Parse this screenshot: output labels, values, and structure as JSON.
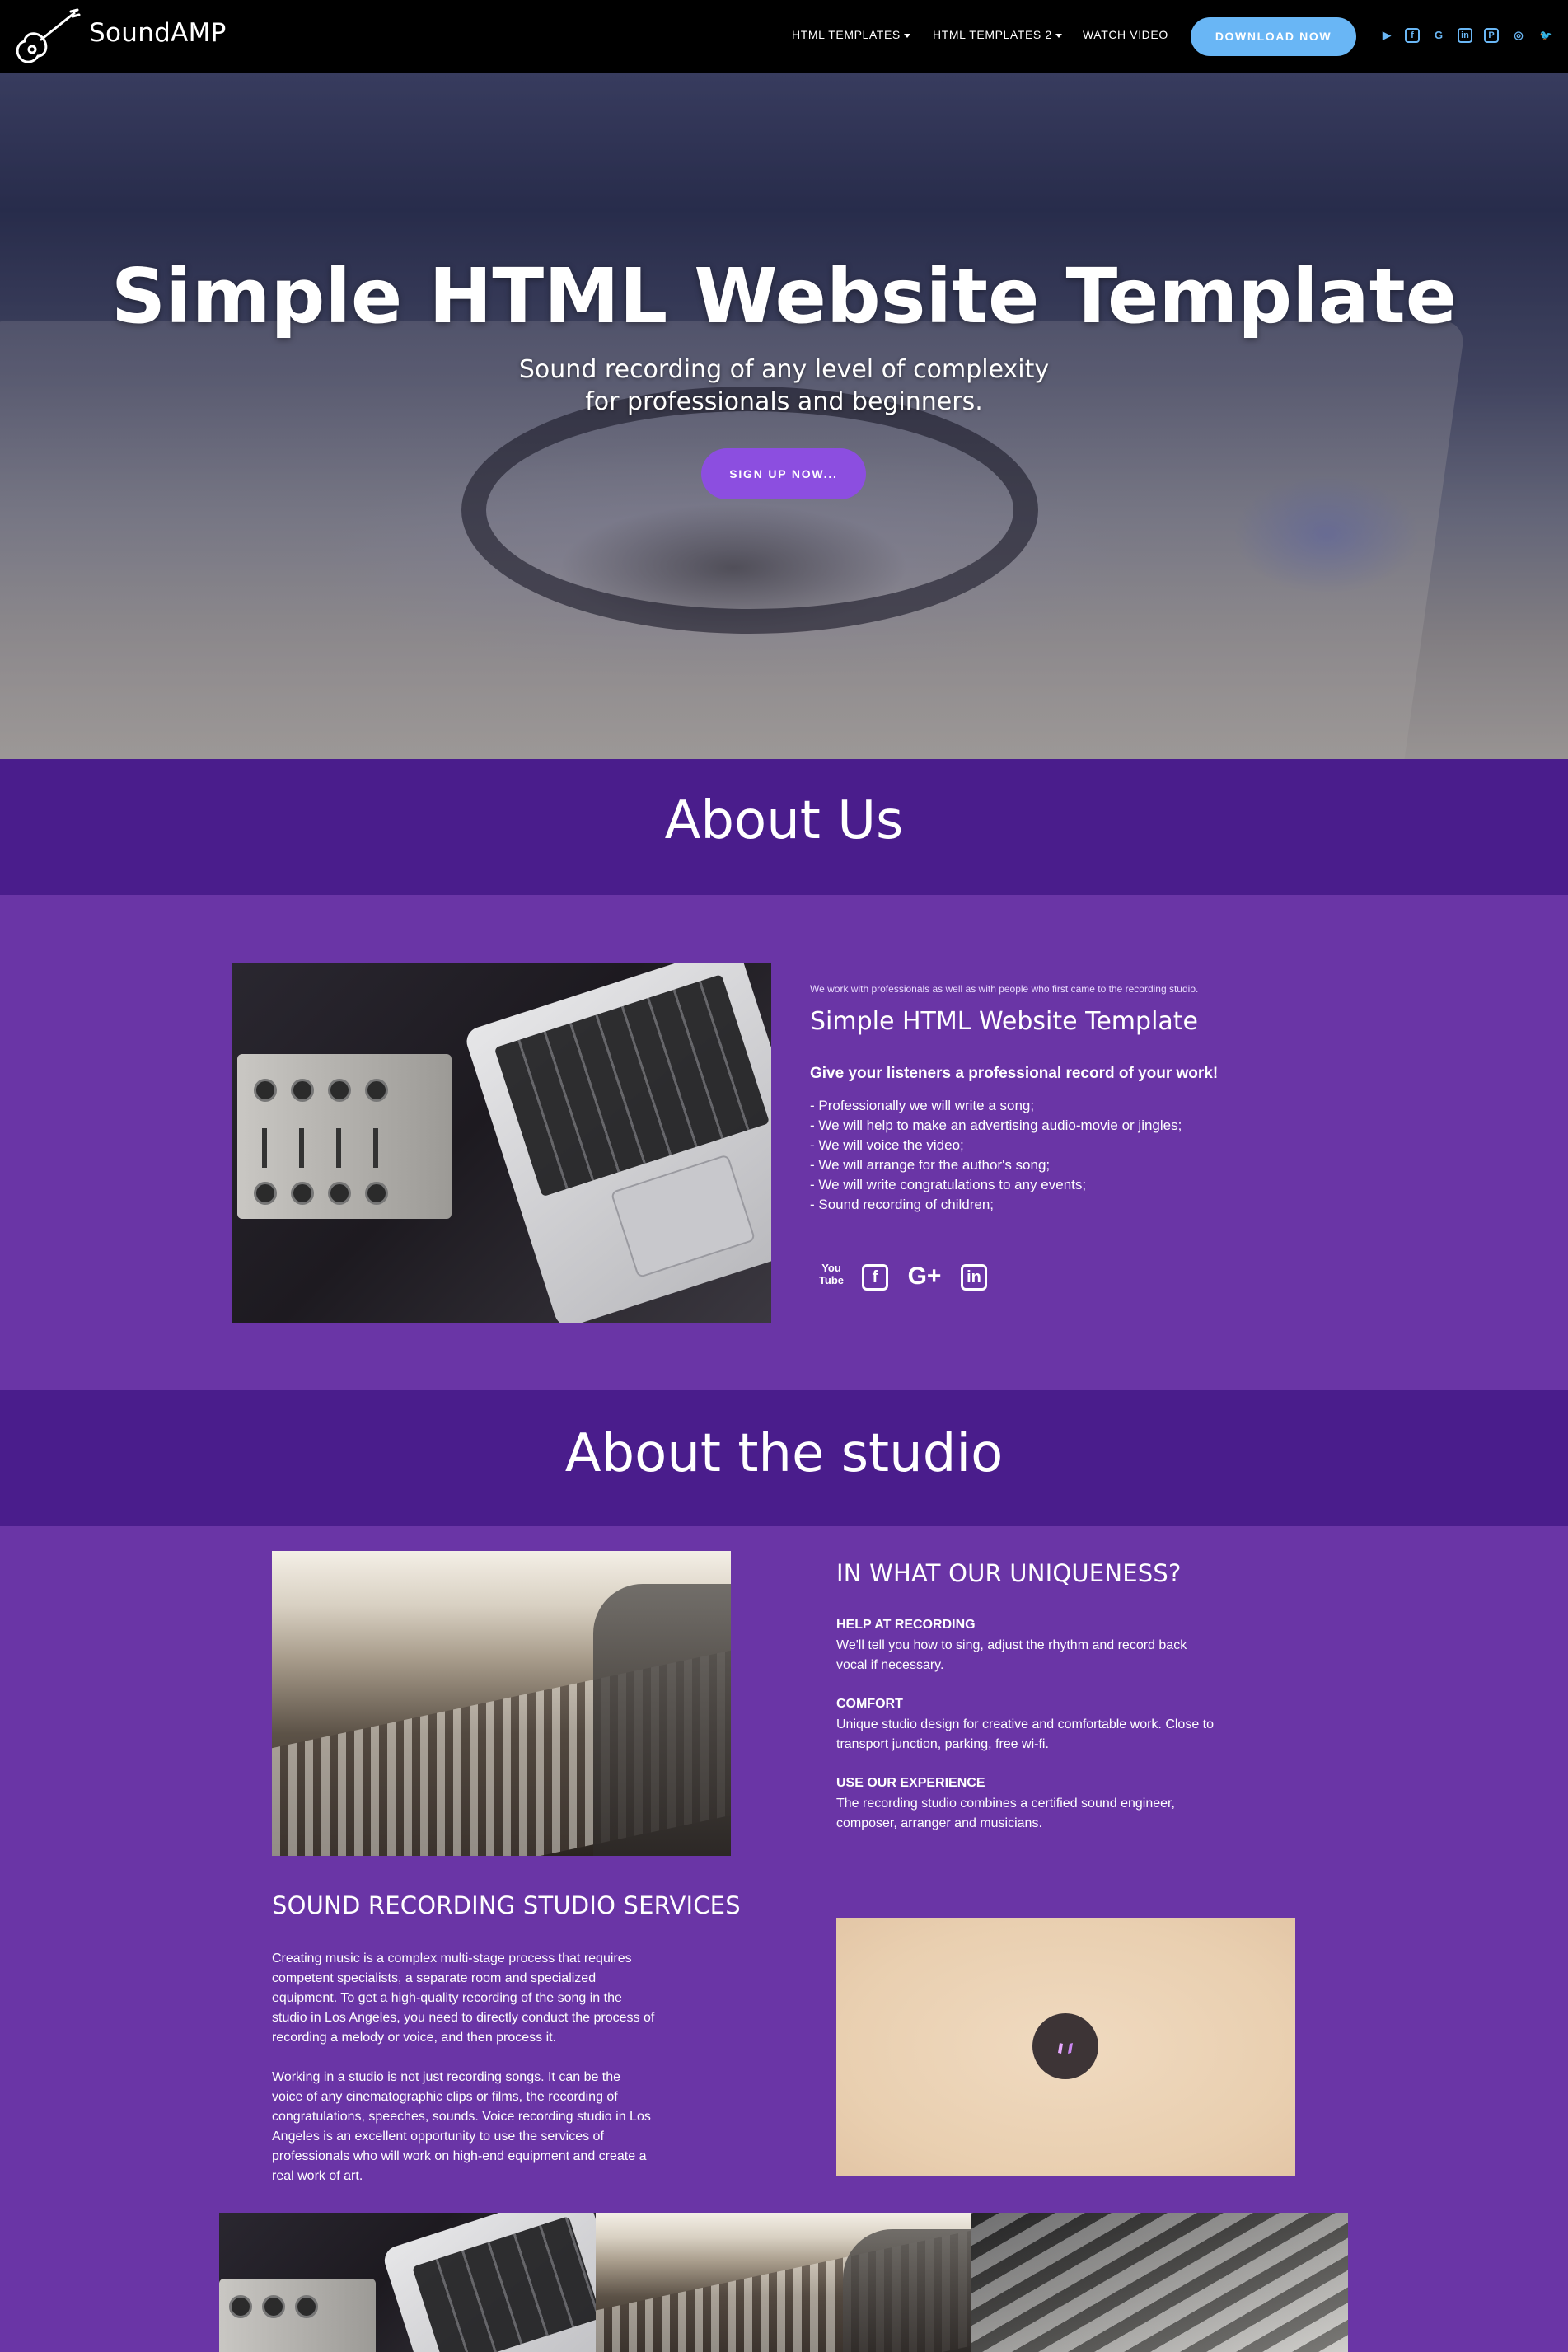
{
  "nav": {
    "brand": "SoundAMP",
    "menu": [
      {
        "label": "HTML TEMPLATES",
        "has_caret": true
      },
      {
        "label": "HTML TEMPLATES 2",
        "has_caret": true
      },
      {
        "label": "WATCH VIDEO",
        "has_caret": false
      }
    ],
    "download_label": "DOWNLOAD NOW",
    "social": [
      {
        "icon": "youtube-icon",
        "glyph": "▶"
      },
      {
        "icon": "facebook-icon",
        "glyph": "f"
      },
      {
        "icon": "google-plus-icon",
        "glyph": "G"
      },
      {
        "icon": "linkedin-icon",
        "glyph": "in"
      },
      {
        "icon": "pinterest-icon",
        "glyph": "P"
      },
      {
        "icon": "instagram-icon",
        "glyph": "◎"
      },
      {
        "icon": "twitter-icon",
        "glyph": "🐦"
      }
    ],
    "accent_color": "#69b6f5"
  },
  "hero": {
    "title": "Simple HTML Website Template",
    "subtitle_line1": "Sound recording of any level of complexity",
    "subtitle_line2": "for professionals and beginners.",
    "cta_label": "SIGN UP NOW...",
    "cta_color": "#8c4ee0"
  },
  "about": {
    "section_title": "About Us",
    "intro": "We work with professionals as well as with people who first came to the recording studio.",
    "heading": "Simple HTML Website Template",
    "subheading": "Give your listeners a professional record of your work!",
    "services": [
      "- Professionally we will write a song;",
      "- We will help to make an advertising audio-movie or jingles;",
      "- We will voice the video;",
      "- We will arrange for the author's song;",
      "- We will write congratulations to any events;",
      "- Sound recording of children;"
    ],
    "social": [
      {
        "icon": "youtube-icon",
        "glyph": "You\nTube"
      },
      {
        "icon": "facebook-icon",
        "glyph": "f"
      },
      {
        "icon": "google-plus-icon",
        "glyph": "G+"
      },
      {
        "icon": "linkedin-icon",
        "glyph": "in"
      }
    ]
  },
  "studio": {
    "section_title": "About the studio",
    "uniqueness_heading": "IN WHAT OUR UNIQUENESS?",
    "features": [
      {
        "title": "HELP AT RECORDING",
        "text_line1": "We'll tell you how to sing, adjust the rhythm and record back",
        "text_line2": "vocal if necessary."
      },
      {
        "title": "COMFORT",
        "text_line1": "Unique studio design for creative and comfortable work. Close to",
        "text_line2": "transport junction, parking, free wi-fi."
      },
      {
        "title": "USE OUR EXPERIENCE",
        "text_line1": "The recording studio combines a certified sound engineer,",
        "text_line2": "composer, arranger and musicians."
      }
    ],
    "services_heading": "SOUND RECORDING STUDIO SERVICES",
    "para1": [
      "Creating music is a complex multi-stage process that requires",
      "competent specialists, a separate room and specialized",
      "equipment. To get a high-quality recording of the song in the",
      "studio in Los Angeles, you need to directly conduct the process of",
      "recording a melody or voice, and then process it."
    ],
    "para2": [
      "Working in a studio is not just recording songs. It can be the",
      "voice of any cinematographic clips or films, the recording of",
      "congratulations, speeches, sounds. Voice recording studio in Los",
      "Angeles is an excellent opportunity to use the services of",
      "professionals who will work on high-end equipment and create a",
      "real work of art."
    ]
  },
  "colors": {
    "nav_bg": "#000000",
    "section_header_bg": "#4a1d8c",
    "section_body_bg": "#6a35a6"
  }
}
